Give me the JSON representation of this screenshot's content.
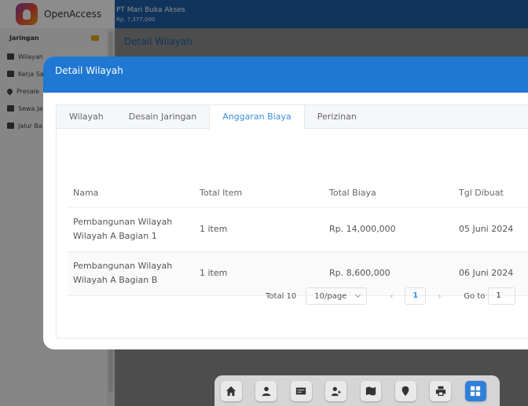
{
  "brand": {
    "name": "OpenAccess"
  },
  "topbar": {
    "org_name": "PT Mari Buka Akses",
    "balance": "Rp. 7,377,000"
  },
  "sidebar": {
    "section": "Jaringan",
    "items": [
      {
        "label": "Wilayah",
        "icon": "map-icon"
      },
      {
        "label": "Kerja Sa",
        "icon": "handshake-icon"
      },
      {
        "label": "Presale",
        "icon": "pin-icon"
      },
      {
        "label": "Sewa Ja",
        "icon": "cart-icon"
      },
      {
        "label": "Jalur Ba",
        "icon": "signpost-icon"
      }
    ]
  },
  "page": {
    "title": "Detail Wilayah"
  },
  "modal": {
    "title": "Detail Wilayah",
    "tabs": [
      "Wilayah",
      "Desain Jaringan",
      "Anggaran Biaya",
      "Perizinan"
    ],
    "active_tab": 2,
    "table": {
      "headers": [
        "Nama",
        "Total Item",
        "Total Biaya",
        "Tgl Dibuat"
      ],
      "rows": [
        {
          "nama": "Pembangunan Wilayah Wilayah A Bagian 1",
          "total_item": "1 item",
          "total_biaya": "Rp. 14,000,000",
          "tgl": "05 Juni 2024"
        },
        {
          "nama": "Pembangunan Wilayah Wilayah A Bagian B",
          "total_item": "1 item",
          "total_biaya": "Rp. 8,600,000",
          "tgl": "06 Juni 2024"
        }
      ]
    },
    "pagination": {
      "total": "Total 10",
      "page_size": "10/page",
      "current_page": "1",
      "goto_label": "Go to",
      "goto_value": "1"
    }
  },
  "dock": [
    "home-icon",
    "user-icon",
    "card-icon",
    "user-share-icon",
    "map-icon",
    "location-icon",
    "print-icon",
    "grid-icon"
  ],
  "colors": {
    "primary": "#1f78d1",
    "topbar": "#1f5fa8",
    "active_tab": "#3b8fe0"
  }
}
